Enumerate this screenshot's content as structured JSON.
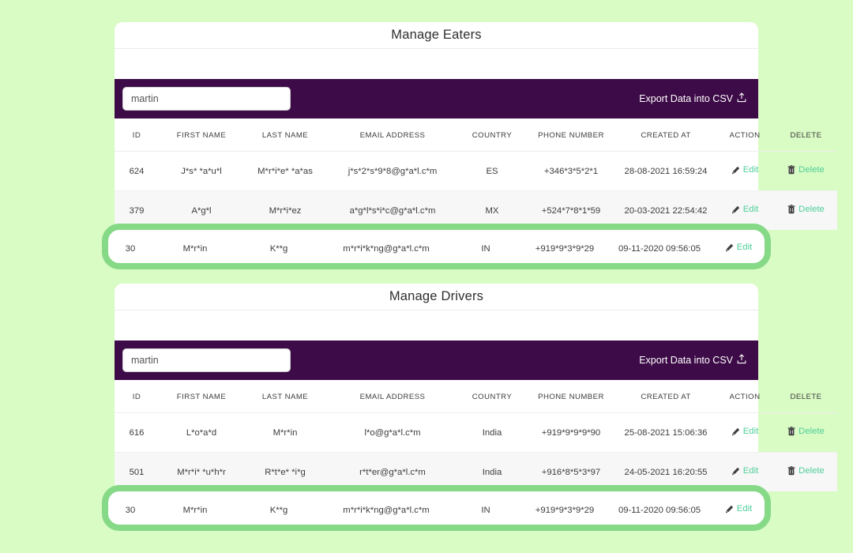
{
  "theme": {
    "page_background": "#d9fbc4",
    "toolbar_purple": "#3d0b47",
    "accent_green": "#4fcf9a",
    "highlight_green": "#85d987",
    "card_white": "#ffffff"
  },
  "columns": [
    "ID",
    "FIRST NAME",
    "LAST NAME",
    "EMAIL ADDRESS",
    "COUNTRY",
    "PHONE NUMBER",
    "CREATED AT",
    "ACTION",
    "DELETE"
  ],
  "actions": {
    "edit_label": "Edit",
    "delete_label": "Delete",
    "edit_icon": "pencil-icon",
    "delete_icon": "trash-icon"
  },
  "eaters": {
    "title": "Manage Eaters",
    "search": {
      "value": "martin",
      "placeholder": "martin",
      "icon": "search-input"
    },
    "export": {
      "label": "Export Data into CSV",
      "icon": "export-upload-icon"
    },
    "rows": [
      {
        "id": "624",
        "first_name": "J*s* *a*u*l",
        "last_name": "M*r*i*e* *a*as",
        "email": "j*s*2*s*9*8@g*a*l.c*m",
        "country": "ES",
        "phone": "+346*3*5*2*1",
        "created_at": "28-08-2021 16:59:24"
      },
      {
        "id": "379",
        "first_name": "A*g*l",
        "last_name": "M*r*i*ez",
        "email": "a*g*l*s*i*c@g*a*l.c*m",
        "country": "MX",
        "phone": "+524*7*8*1*59",
        "created_at": "20-03-2021 22:54:42"
      }
    ],
    "highlighted_row": {
      "id": "30",
      "first_name": "M*r*in",
      "last_name": "K**g",
      "email": "m*r*i*k*ng@g*a*l.c*m",
      "country": "IN",
      "phone": "+919*9*3*9*29",
      "created_at": "09-11-2020 09:56:05"
    }
  },
  "drivers": {
    "title": "Manage Drivers",
    "search": {
      "value": "martin",
      "placeholder": "martin",
      "icon": "search-input"
    },
    "export": {
      "label": "Export Data into CSV",
      "icon": "export-upload-icon"
    },
    "rows": [
      {
        "id": "616",
        "first_name": "L*o*a*d",
        "last_name": "M*r*in",
        "email": "l*o@g*a*l.c*m",
        "country": "India",
        "phone": "+919*9*9*9*90",
        "created_at": "25-08-2021 15:06:36"
      },
      {
        "id": "501",
        "first_name": "M*r*i* *u*h*r",
        "last_name": "R*t*e* *i*g",
        "email": "r*t*er@g*a*l.c*m",
        "country": "India",
        "phone": "+916*8*5*3*97",
        "created_at": "24-05-2021 16:20:55"
      }
    ],
    "highlighted_row": {
      "id": "30",
      "first_name": "M*r*in",
      "last_name": "K**g",
      "email": "m*r*i*k*ng@g*a*l.c*m",
      "country": "IN",
      "phone": "+919*9*3*9*29",
      "created_at": "09-11-2020 09:56:05"
    }
  }
}
